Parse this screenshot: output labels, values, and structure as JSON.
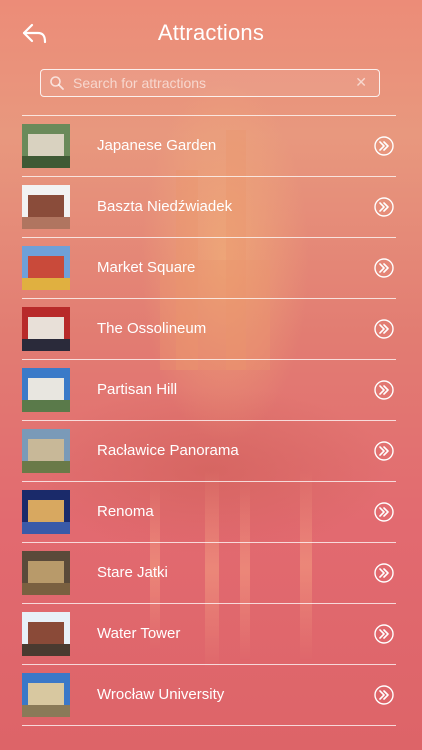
{
  "header": {
    "title": "Attractions",
    "back_icon": "back-arrow-icon"
  },
  "search": {
    "placeholder": "Search for attractions",
    "value": "",
    "icon": "search-icon",
    "clear_icon": "clear-icon"
  },
  "attractions": [
    {
      "name": "Japanese Garden",
      "thumb_colors": [
        "#6a8a5a",
        "#d9d2c0",
        "#3f5a35"
      ]
    },
    {
      "name": "Baszta Niedźwiadek",
      "thumb_colors": [
        "#f2f2f2",
        "#8a4c3a",
        "#b07560"
      ]
    },
    {
      "name": "Market Square",
      "thumb_colors": [
        "#6fa0d8",
        "#c94a3a",
        "#e0b040"
      ]
    },
    {
      "name": "The Ossolineum",
      "thumb_colors": [
        "#b82a2a",
        "#e8e0d8",
        "#2a2a3a"
      ]
    },
    {
      "name": "Partisan Hill",
      "thumb_colors": [
        "#3a7ac8",
        "#e8e6e0",
        "#5a7a4a"
      ]
    },
    {
      "name": "Racławice Panorama",
      "thumb_colors": [
        "#7a9ab8",
        "#c8b898",
        "#6a7a48"
      ]
    },
    {
      "name": "Renoma",
      "thumb_colors": [
        "#1a2a6a",
        "#d8a860",
        "#3a5aa8"
      ]
    },
    {
      "name": "Stare Jatki",
      "thumb_colors": [
        "#5a4a3a",
        "#b89a6a",
        "#7a6040"
      ]
    },
    {
      "name": "Water Tower",
      "thumb_colors": [
        "#e8f0f8",
        "#8a4a38",
        "#4a3a30"
      ]
    },
    {
      "name": "Wrocław University",
      "thumb_colors": [
        "#3a78c8",
        "#d8c8a0",
        "#8a7a58"
      ]
    }
  ],
  "row_action_icon": "chevron-double-right-icon"
}
